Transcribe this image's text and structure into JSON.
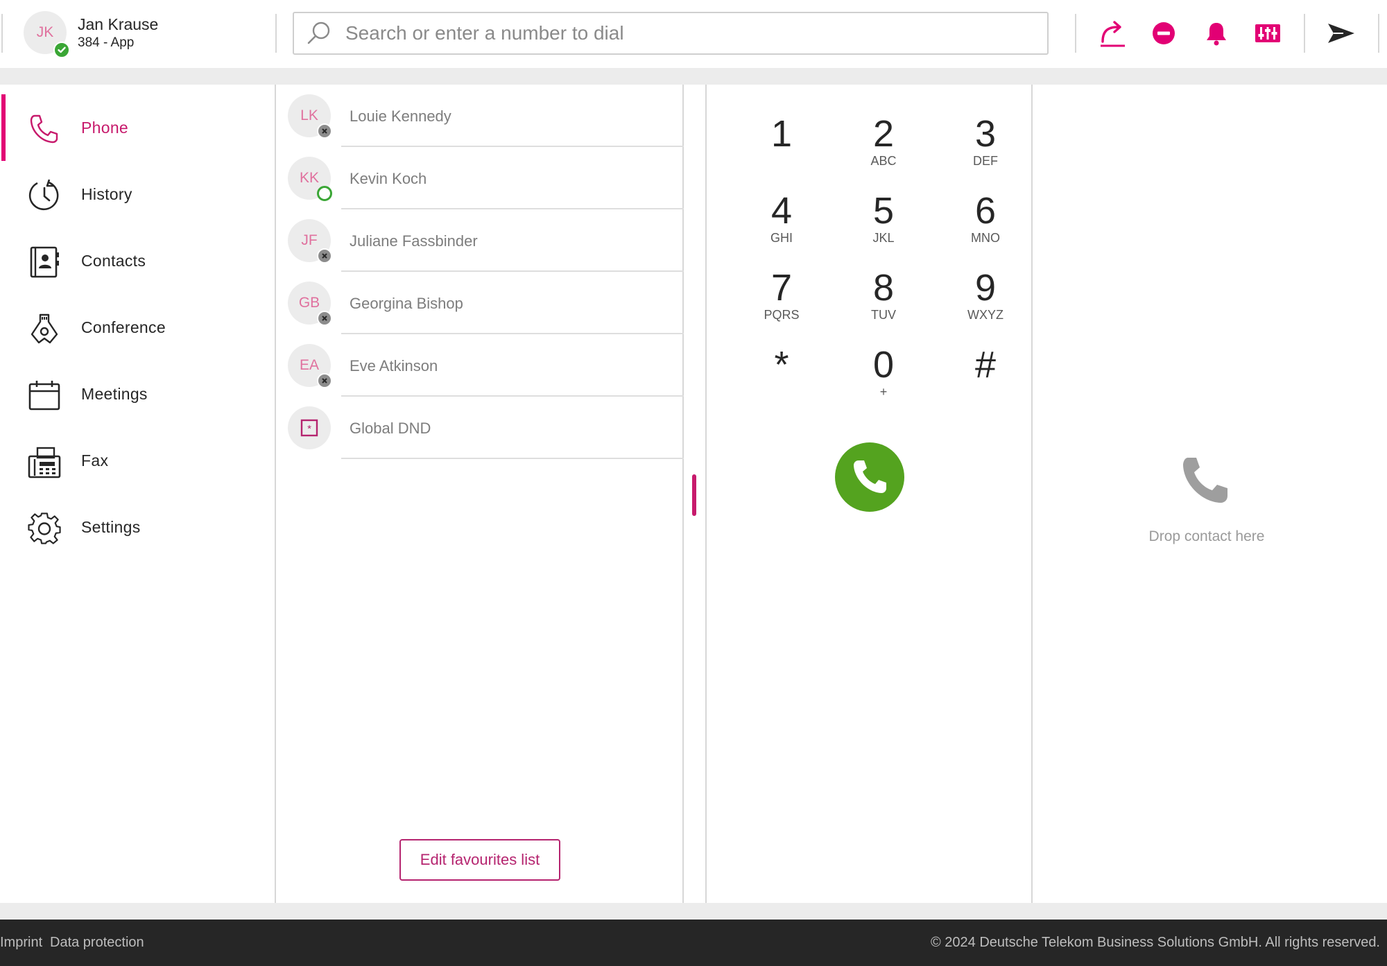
{
  "user": {
    "initials": "JK",
    "name": "Jan Krause",
    "subtitle": "384 - App",
    "status": "available"
  },
  "search": {
    "placeholder": "Search or enter a number to dial",
    "value": ""
  },
  "header_actions": [
    {
      "name": "call-forwarding-button",
      "icon": "forward-arrow-icon"
    },
    {
      "name": "do-not-disturb-button",
      "icon": "dnd-icon"
    },
    {
      "name": "notifications-button",
      "icon": "bell-icon"
    },
    {
      "name": "audio-settings-button",
      "icon": "equalizer-icon"
    },
    {
      "name": "send-button",
      "icon": "send-icon"
    }
  ],
  "nav": {
    "items": [
      {
        "label": "Phone",
        "icon": "phone-icon",
        "active": true
      },
      {
        "label": "History",
        "icon": "history-icon"
      },
      {
        "label": "Contacts",
        "icon": "contacts-icon"
      },
      {
        "label": "Conference",
        "icon": "conference-icon"
      },
      {
        "label": "Meetings",
        "icon": "calendar-icon"
      },
      {
        "label": "Fax",
        "icon": "fax-icon"
      },
      {
        "label": "Settings",
        "icon": "gear-icon"
      }
    ]
  },
  "favourites": {
    "items": [
      {
        "initials": "LK",
        "name": "Louie Kennedy",
        "status": "offline"
      },
      {
        "initials": "KK",
        "name": "Kevin Koch",
        "status": "online"
      },
      {
        "initials": "JF",
        "name": "Juliane Fassbinder",
        "status": "offline"
      },
      {
        "initials": "GB",
        "name": "Georgina Bishop",
        "status": "offline"
      },
      {
        "initials": "EA",
        "name": "Eve Atkinson",
        "status": "offline"
      },
      {
        "initials": "",
        "name": "Global DND",
        "status": "feature"
      }
    ],
    "edit_label": "Edit favourites list"
  },
  "dialpad": {
    "keys": [
      {
        "digit": "1",
        "letters": ""
      },
      {
        "digit": "2",
        "letters": "ABC"
      },
      {
        "digit": "3",
        "letters": "DEF"
      },
      {
        "digit": "4",
        "letters": "GHI"
      },
      {
        "digit": "5",
        "letters": "JKL"
      },
      {
        "digit": "6",
        "letters": "MNO"
      },
      {
        "digit": "7",
        "letters": "PQRS"
      },
      {
        "digit": "8",
        "letters": "TUV"
      },
      {
        "digit": "9",
        "letters": "WXYZ"
      },
      {
        "digit": "*",
        "letters": ""
      },
      {
        "digit": "0",
        "letters": "+"
      },
      {
        "digit": "#",
        "letters": ""
      }
    ]
  },
  "dropzone": {
    "text": "Drop contact here"
  },
  "footer": {
    "links": [
      "Imprint",
      "Data protection"
    ],
    "copyright": "© 2024 Deutsche Telekom Business Solutions GmbH. All rights reserved."
  },
  "colors": {
    "brand": "#e20074",
    "accent_text": "#c71a6c",
    "call_green": "#54a31f",
    "online": "#3aa635",
    "footer_bg": "#262626"
  }
}
